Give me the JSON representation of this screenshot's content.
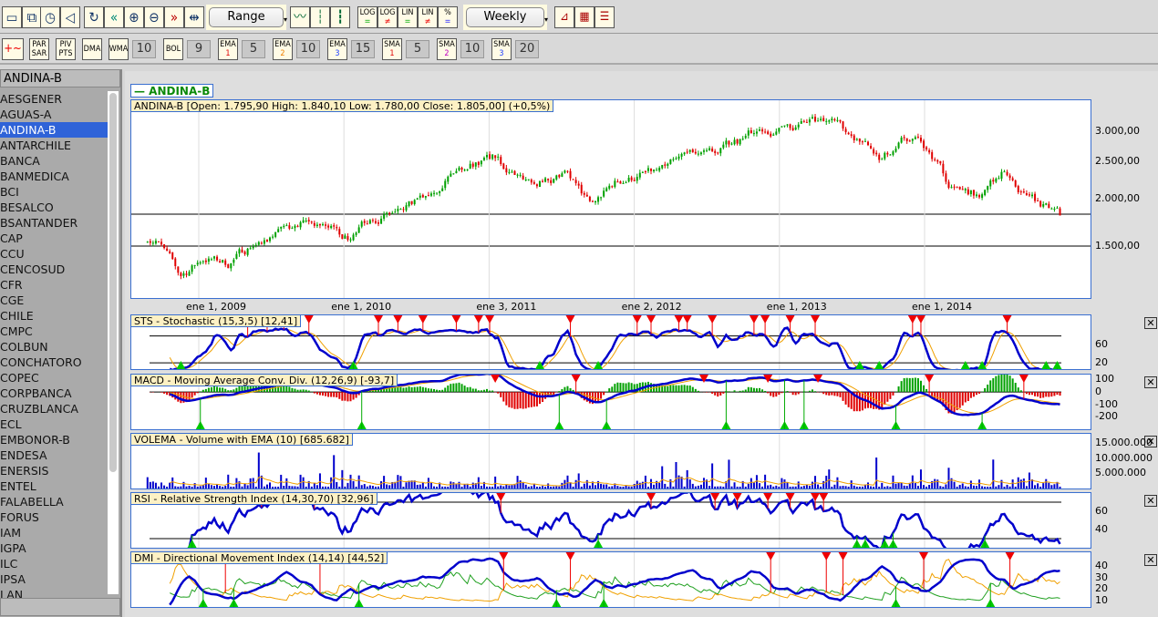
{
  "toolbar1": {
    "buttons": [
      "window-icon",
      "restore-icon",
      "stopwatch-icon",
      "speaker-icon",
      "refresh-icon",
      "rewind-icon",
      "zoom-in-icon",
      "zoom-out-icon",
      "fast-forward-icon",
      "fit-icon"
    ],
    "range_label": "Range",
    "chart_types": [
      "line-chart-icon",
      "bar-chart-icon",
      "candle-chart-icon"
    ],
    "scale_buttons": [
      {
        "top": "LOG",
        "bottom": "="
      },
      {
        "top": "LOG",
        "bottom": "≠"
      },
      {
        "top": "LIN",
        "bottom": "="
      },
      {
        "top": "LIN",
        "bottom": "≠"
      },
      {
        "top": "%",
        "bottom": "="
      }
    ],
    "period_label": "Weekly",
    "extra": [
      "chart-settings-icon",
      "colors-icon",
      "report-icon"
    ]
  },
  "toolbar2": {
    "items": [
      {
        "top": "PAR",
        "bottom": "SAR"
      },
      {
        "top": "PIV",
        "bottom": "PTS"
      },
      {
        "top": "DMA",
        "bottom": ""
      },
      {
        "top": "WMA",
        "bottom": "",
        "value": "10"
      },
      {
        "top": "BOL",
        "bottom": "",
        "value": "9"
      },
      {
        "top": "EMA",
        "bottom": "1",
        "value": "5",
        "color": "#e00000"
      },
      {
        "top": "EMA",
        "bottom": "2",
        "value": "10",
        "color": "#f08000"
      },
      {
        "top": "EMA",
        "bottom": "3",
        "value": "15",
        "color": "#2040ff"
      },
      {
        "top": "SMA",
        "bottom": "1",
        "value": "5",
        "color": "#e00000"
      },
      {
        "top": "SMA",
        "bottom": "2",
        "value": "10",
        "color": "#c000c0"
      },
      {
        "top": "SMA",
        "bottom": "3",
        "value": "20",
        "color": "#2040ff"
      }
    ]
  },
  "sidebar": {
    "selected": "ANDINA-B",
    "items": [
      "AESGENER",
      "AGUAS-A",
      "ANDINA-B",
      "ANTARCHILE",
      "BANCA",
      "BANMEDICA",
      "BCI",
      "BESALCO",
      "BSANTANDER",
      "CAP",
      "CCU",
      "CENCOSUD",
      "CFR",
      "CGE",
      "CHILE",
      "CMPC",
      "COLBUN",
      "CONCHATORO",
      "COPEC",
      "CORPBANCA",
      "CRUZBLANCA",
      "ECL",
      "EMBONOR-B",
      "ENDESA",
      "ENERSIS",
      "ENTEL",
      "FALABELLA",
      "FORUS",
      "IAM",
      "IGPA",
      "ILC",
      "IPSA",
      "LAN"
    ]
  },
  "chart": {
    "legend": "— ANDINA-B",
    "info": "ANDINA-B [Open: 1.795,90  High: 1.840,10  Low: 1.780,00  Close: 1.805,00] (+0,5%)",
    "y_ticks": [
      "3.000,00",
      "2.500,00",
      "2.000,00",
      "1.500,00"
    ],
    "x_ticks": [
      "ene 1, 2009",
      "ene 1, 2010",
      "ene 3, 2011",
      "ene 2, 2012",
      "ene 1, 2013",
      "ene 1, 2014"
    ]
  },
  "panels": [
    {
      "title": "STS - Stochastic (15,3,5) [12,41]",
      "ticks": [
        "60",
        "20"
      ]
    },
    {
      "title": "MACD - Moving Average Conv. Div. (12,26,9) [-93,7]",
      "ticks": [
        "100",
        "0",
        "-100",
        "-200"
      ]
    },
    {
      "title": "VOLEMA - Volume with EMA (10) [685.682]",
      "ticks": [
        "15.000.000",
        "10.000.000",
        "5.000.000"
      ]
    },
    {
      "title": "RSI - Relative Strength Index (14,30,70) [32,96]",
      "ticks": [
        "60",
        "40"
      ]
    },
    {
      "title": "DMI - Directional Movement Index (14,14) [44,52]",
      "ticks": [
        "40",
        "30",
        "20",
        "10"
      ]
    }
  ],
  "colors": {
    "up": "#00a000",
    "down": "#e00000",
    "line": "#0000cc",
    "signal": "#f0a000",
    "accent": "#2f63d8"
  },
  "chart_data": {
    "type": "candlestick",
    "period": "weekly",
    "scale": "log",
    "ylim": [
      1100,
      3600
    ],
    "monthly_close": [
      [
        "2008-09",
        1580
      ],
      [
        "2008-11",
        1250
      ],
      [
        "2009-01",
        1400
      ],
      [
        "2009-03",
        1350
      ],
      [
        "2009-05",
        1520
      ],
      [
        "2009-07",
        1600
      ],
      [
        "2009-09",
        1680
      ],
      [
        "2009-11",
        1720
      ],
      [
        "2010-01",
        1570
      ],
      [
        "2010-03",
        1800
      ],
      [
        "2010-05",
        1830
      ],
      [
        "2010-07",
        1960
      ],
      [
        "2010-09",
        2300
      ],
      [
        "2010-11",
        2480
      ],
      [
        "2011-01",
        2550
      ],
      [
        "2011-03",
        2280
      ],
      [
        "2011-05",
        2250
      ],
      [
        "2011-07",
        2300
      ],
      [
        "2011-09",
        1900
      ],
      [
        "2011-11",
        2200
      ],
      [
        "2012-01",
        2300
      ],
      [
        "2012-03",
        2350
      ],
      [
        "2012-05",
        2600
      ],
      [
        "2012-07",
        2700
      ],
      [
        "2012-09",
        2820
      ],
      [
        "2012-11",
        3050
      ],
      [
        "2013-01",
        3050
      ],
      [
        "2013-03",
        3150
      ],
      [
        "2013-05",
        3100
      ],
      [
        "2013-07",
        2900
      ],
      [
        "2013-09",
        2550
      ],
      [
        "2013-11",
        2850
      ],
      [
        "2014-01",
        2700
      ],
      [
        "2014-03",
        2100
      ],
      [
        "2014-05",
        2050
      ],
      [
        "2014-07",
        2300
      ],
      [
        "2014-09",
        2050
      ],
      [
        "2014-11",
        1850
      ],
      [
        "2014-12",
        1805
      ]
    ],
    "last": {
      "open": 1795.9,
      "high": 1840.1,
      "low": 1780.0,
      "close": 1805.0,
      "change_pct": 0.5
    }
  }
}
